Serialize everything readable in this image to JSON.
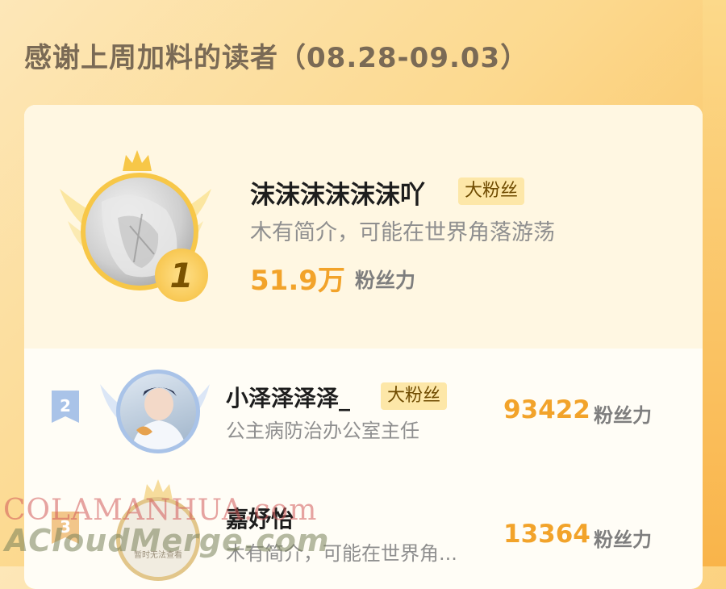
{
  "header": {
    "title": "感谢上周加料的读者（08.28-09.03）"
  },
  "readers": [
    {
      "rank": "1",
      "name": "沫沫沫沫沫沫吖",
      "badge": "大粉丝",
      "bio": "木有简介，可能在世界角落游荡",
      "score": "51.9万",
      "score_unit": "粉丝力"
    },
    {
      "rank": "2",
      "name": "小泽泽泽泽_",
      "badge": "大粉丝",
      "bio": "公主病防治办公室主任",
      "score": "93422",
      "score_unit": "粉丝力"
    },
    {
      "rank": "3",
      "name": "嘉妤怡",
      "badge": "",
      "bio": "木有简介，可能在世界角...",
      "score": "13364",
      "score_unit": "粉丝力",
      "avatar_text": "暂时无法查看"
    }
  ],
  "watermark": {
    "line1": "COLAMANHUA.com",
    "line2": "ACloudMerge.com"
  },
  "colors": {
    "accent": "#f2a32a",
    "badge_bg": "#fde7a8",
    "gold": "#f7c748",
    "silver": "#a9c3e8"
  }
}
